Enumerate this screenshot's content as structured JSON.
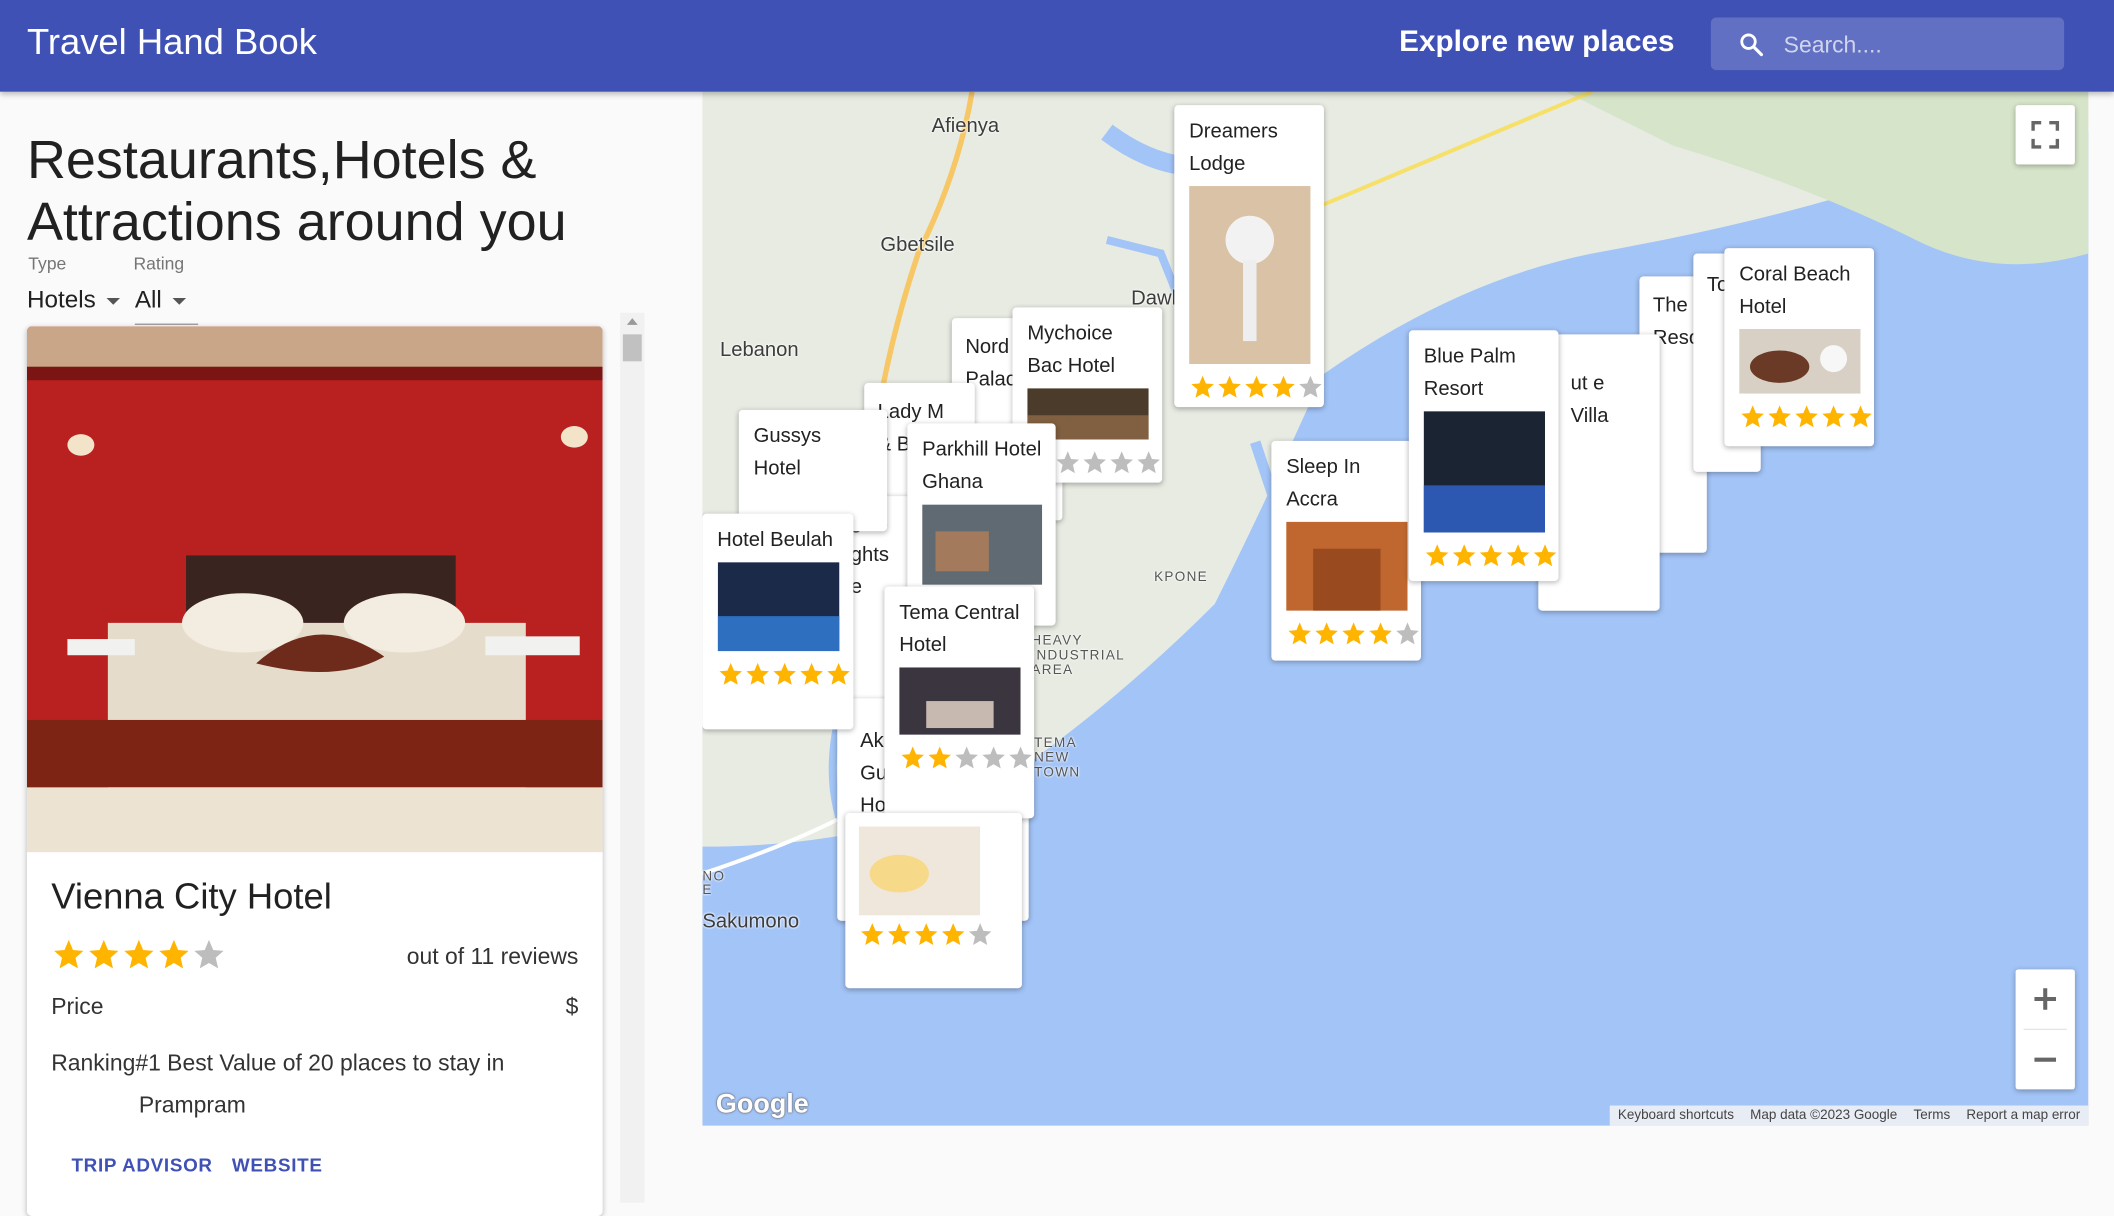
{
  "app": {
    "title": "Travel Hand Book",
    "subtitle": "Explore new places",
    "search_placeholder": "Search...."
  },
  "sidebar": {
    "heading": "Restaurants,Hotels & Attractions around you",
    "type_label": "Type",
    "type_value": "Hotels",
    "rating_label": "Rating",
    "rating_value": "All"
  },
  "place_card": {
    "name": "Vienna City Hotel",
    "rating": 4,
    "reviews": "out of 11 reviews",
    "price_label": "Price",
    "price_value": "$",
    "ranking_line1": "Ranking#1 Best Value of 20 places to stay in",
    "ranking_line2": "Prampram",
    "trip_advisor": "TRIP ADVISOR",
    "website": "WEBSITE"
  },
  "map": {
    "labels": [
      {
        "text": "Afienya"
      },
      {
        "text": "Gbetsile"
      },
      {
        "text": "Lebanon"
      },
      {
        "text": "Dawh"
      },
      {
        "text": "KPONE"
      },
      {
        "text": "HEAVY INDUSTRIAL AREA"
      },
      {
        "text": "TEMA NEW TOWN"
      },
      {
        "text": "Sakumono"
      },
      {
        "text": "NO E"
      }
    ],
    "pins": [
      {
        "name": "Dreamers Lodge",
        "rating": 4
      },
      {
        "name": "Mychoice Bac Hotel",
        "rating": 1
      },
      {
        "name": "Gussys Hotel",
        "rating": 0
      },
      {
        "name": "Parkhill Hotel Ghana",
        "rating": 0
      },
      {
        "name": "Hotel Beulah",
        "rating": 5
      },
      {
        "name": "Tema Central Hotel",
        "rating": 2
      },
      {
        "name": "Sleep In Accra",
        "rating": 4
      },
      {
        "name": "Blue Palm Resort",
        "rating": 5
      },
      {
        "name": "Coral Beach Hotel",
        "rating": 5
      }
    ],
    "partial_names": [
      "Nord Palac",
      "Lady M & Bre",
      "gels ghts e",
      "The Reso",
      "To",
      "ut e Villa",
      "Ak Gu Ho"
    ],
    "logo": "Google",
    "attribution": [
      "Keyboard shortcuts",
      "Map data ©2023 Google",
      "Terms",
      "Report a map error"
    ]
  },
  "colors": {
    "appbar": "#3f51b5",
    "star": "#ffb400",
    "star_empty": "#bdbdbd",
    "water": "#a3c4f7",
    "land": "#e6ebe1",
    "link": "#3f51b5"
  }
}
